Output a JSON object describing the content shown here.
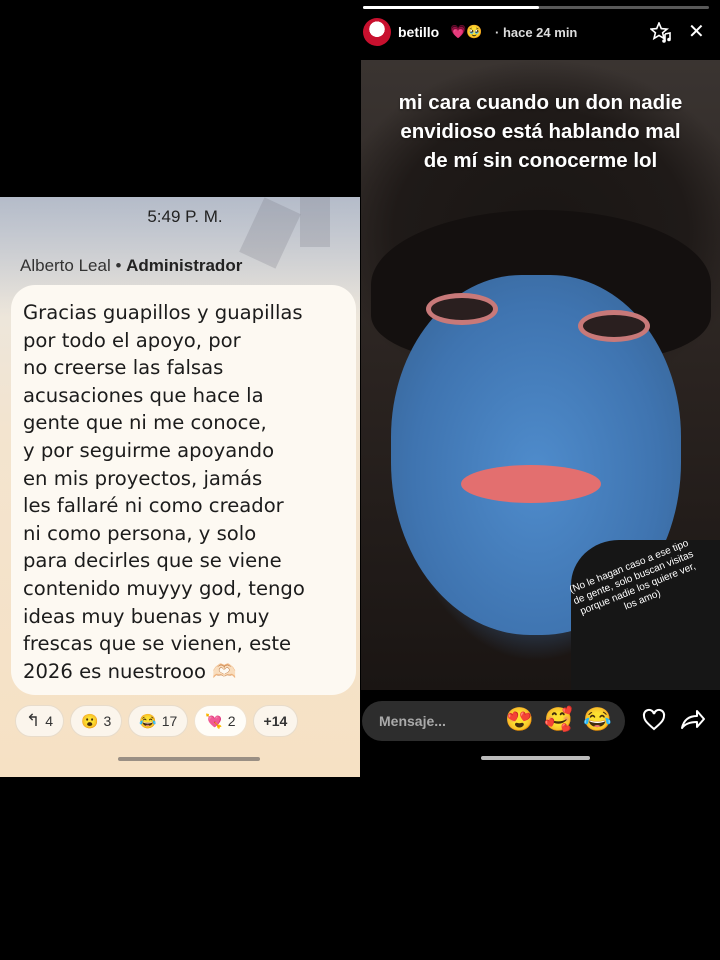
{
  "chat": {
    "time": "5:49 P. M.",
    "sender_name": "Alberto Leal",
    "sender_separator": " • ",
    "sender_role": "Administrador",
    "message": "Gracias guapillos y guapillas\npor todo el apoyo, por\nno creerse las falsas\nacusaciones que hace la\ngente que ni me conoce,\ny por seguirme apoyando\nen mis proyectos, jamás\nles fallaré ni como creador\nni como persona, y solo\npara decirles que se viene\ncontenido muyyy god, tengo\nideas muy buenas y muy\nfrescas que se vienen, este\n2026 es nuestrooo 🫶🏻",
    "reactions": [
      {
        "icon": "↰",
        "count": "4"
      },
      {
        "icon": "😮",
        "count": "3"
      },
      {
        "icon": "😂",
        "count": "17"
      },
      {
        "icon": "💘",
        "count": "2"
      }
    ],
    "more_reactions": "+14"
  },
  "story": {
    "username": "betillo",
    "user_decor": "💗🥹",
    "time_ago": "· hace 24 min",
    "progress": 0.51,
    "caption": "mi cara cuando un don nadie\nenvidioso está hablando mal\nde mí sin conocerme lol",
    "side_note": "(No le hagan caso a ese tipo\nde gente, solo buscan visitas\nporque nadie los quiere ver,\nlos amo)",
    "message_placeholder": "Mensaje...",
    "quick_reactions": [
      "😍",
      "🥰",
      "😂"
    ],
    "icons": {
      "avatar": "avatar",
      "add_music": "star-music-icon",
      "close": "close-icon",
      "like": "heart-icon",
      "share": "send-icon"
    },
    "close_glyph": "✕"
  }
}
